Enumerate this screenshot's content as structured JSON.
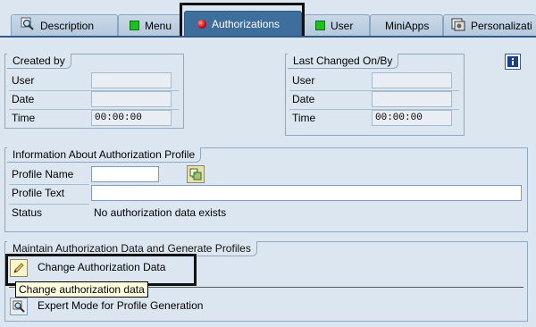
{
  "tabs": [
    {
      "label": "Description",
      "icon": "magnifier-icon"
    },
    {
      "label": "Menu",
      "icon": "green-square-icon"
    },
    {
      "label": "Authorizations",
      "icon": "red-dot-icon",
      "active": true
    },
    {
      "label": "User",
      "icon": "green-square-icon"
    },
    {
      "label": "MiniApps",
      "icon": ""
    },
    {
      "label": "Personalizati",
      "icon": "personalization-icon"
    }
  ],
  "created_by": {
    "title": "Created by",
    "user_label": "User",
    "user_value": "",
    "date_label": "Date",
    "date_value": "",
    "time_label": "Time",
    "time_value": "00:00:00"
  },
  "last_changed": {
    "title": "Last Changed On/By",
    "user_label": "User",
    "user_value": "",
    "date_label": "Date",
    "date_value": "",
    "time_label": "Time",
    "time_value": "00:00:00"
  },
  "profile_info": {
    "title": "Information About Authorization Profile",
    "profile_name_label": "Profile Name",
    "profile_name_value": "",
    "profile_text_label": "Profile Text",
    "profile_text_value": "",
    "status_label": "Status",
    "status_value": "No authorization data exists"
  },
  "maintain": {
    "title": "Maintain Authorization Data and Generate Profiles",
    "change_label": "Change Authorization Data",
    "tooltip": "Change authorization data",
    "expert_label": "Expert Mode for Profile Generation"
  },
  "colors": {
    "active_tab": "#3e6e9c",
    "background": "#dce6f0",
    "highlight": "#111111"
  }
}
